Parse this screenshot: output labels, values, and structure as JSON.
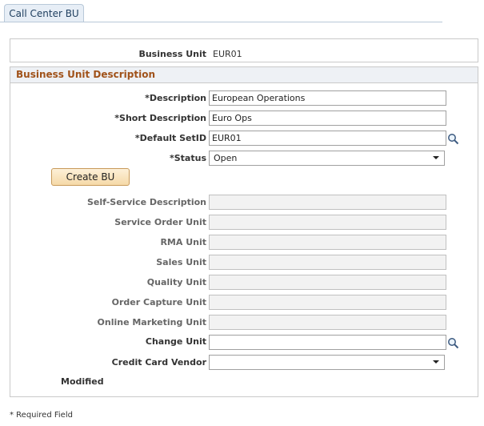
{
  "tab": {
    "label": "Call Center BU"
  },
  "header": {
    "business_unit_label": "Business Unit",
    "business_unit_value": "EUR01"
  },
  "group": {
    "title": "Business Unit Description"
  },
  "fields": {
    "description": {
      "label": "*Description",
      "value": "European Operations"
    },
    "short_description": {
      "label": "*Short Description",
      "value": "Euro Ops"
    },
    "default_setid": {
      "label": "*Default SetID",
      "value": "EUR01"
    },
    "status": {
      "label": "*Status",
      "value": "Open"
    },
    "create_bu_label": "Create BU",
    "self_service_description": {
      "label": "Self-Service Description",
      "value": ""
    },
    "service_order_unit": {
      "label": "Service Order Unit",
      "value": ""
    },
    "rma_unit": {
      "label": "RMA Unit",
      "value": ""
    },
    "sales_unit": {
      "label": "Sales Unit",
      "value": ""
    },
    "quality_unit": {
      "label": "Quality Unit",
      "value": ""
    },
    "order_capture_unit": {
      "label": "Order Capture Unit",
      "value": ""
    },
    "online_marketing_unit": {
      "label": "Online Marketing Unit",
      "value": ""
    },
    "change_unit": {
      "label": "Change Unit",
      "value": ""
    },
    "credit_card_vendor": {
      "label": "Credit Card Vendor",
      "value": ""
    },
    "modified_label": "Modified"
  },
  "footer": {
    "required_note": "* Required Field"
  },
  "colors": {
    "group_title": "#a0521a",
    "tab_bg": "#e7eef6",
    "button_bg": "#f5d9a8"
  },
  "icons": {
    "lookup": "magnifier-icon",
    "dropdown": "chevron-down-icon"
  }
}
